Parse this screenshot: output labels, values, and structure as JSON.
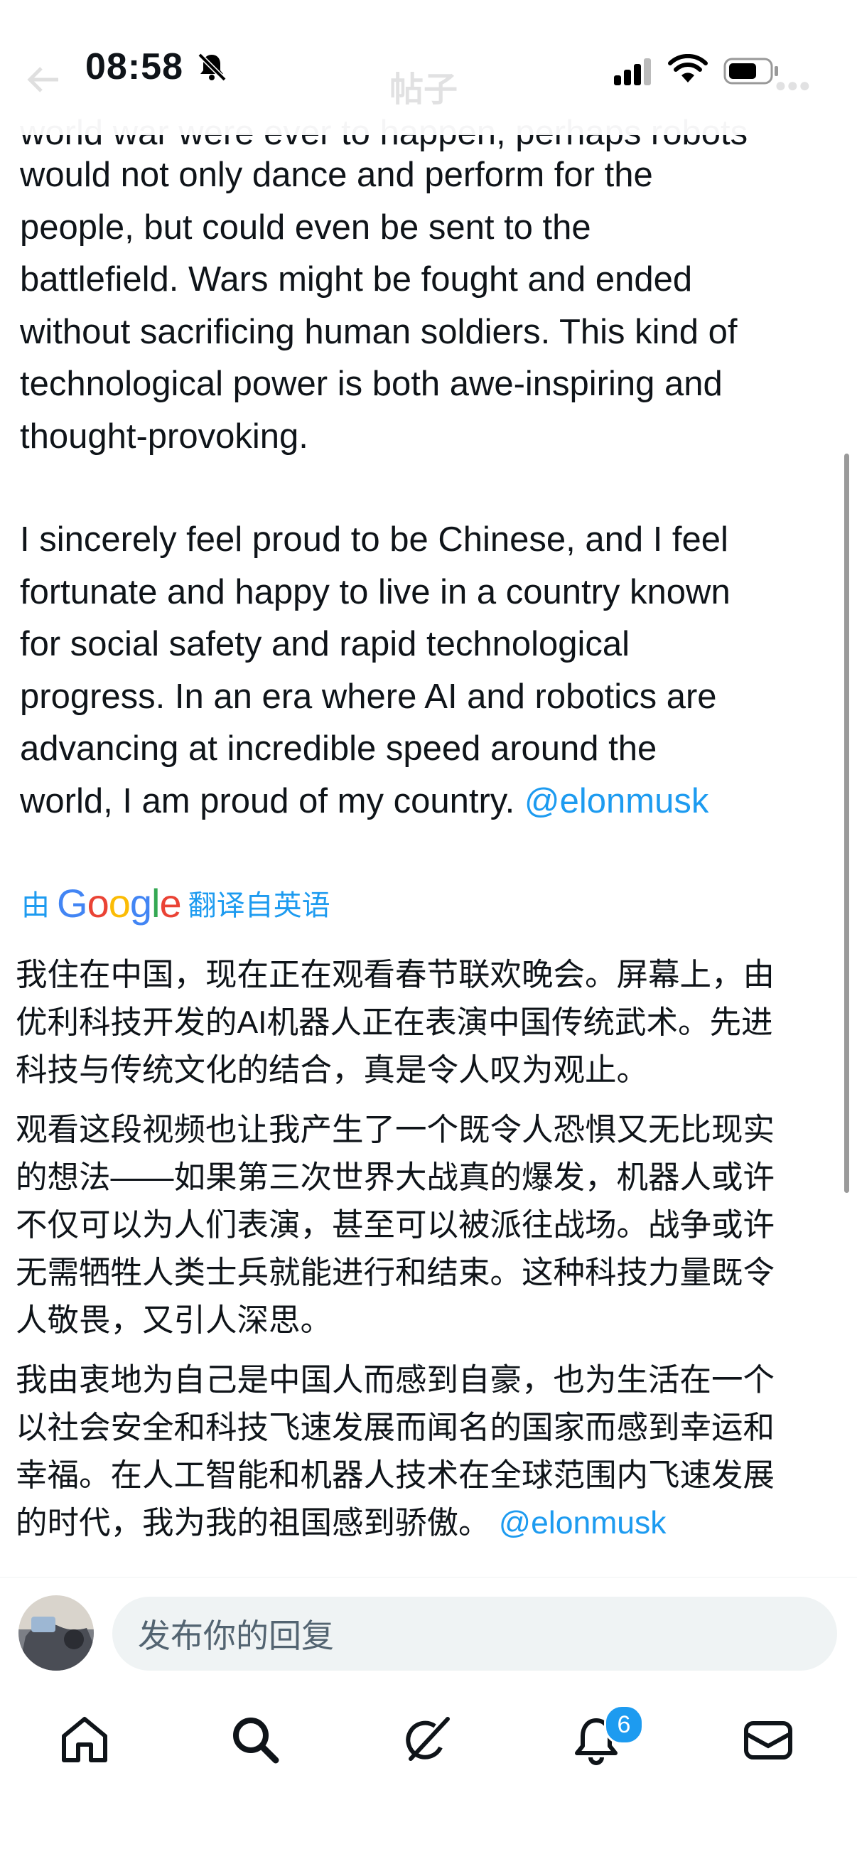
{
  "status_bar": {
    "time": "08:58",
    "ghost_title": "帖子"
  },
  "post": {
    "cut_line": "world war were ever to happen, perhaps robots",
    "en_paragraph_1": [
      "would not only dance and perform for the",
      "people, but could even be sent to the",
      "battlefield. Wars might be fought and ended",
      "without sacrificing human soldiers. This kind of",
      "technological power is both awe-inspiring and",
      "thought-provoking."
    ],
    "en_paragraph_2": [
      "I sincerely feel proud to be Chinese, and I feel",
      "fortunate and happy to live in a country known",
      "for social safety and rapid technological",
      "progress. In an era where AI and robotics are",
      "advancing at incredible speed around the"
    ],
    "en_last_line": "world, I am proud of my country.",
    "mention": "@elonmusk",
    "translation_prefix": "由",
    "translation_brand": "Google",
    "translation_suffix": "翻译自英语",
    "zh_paragraph_1": [
      "我住在中国，现在正在观看春节联欢晚会。屏幕上，由",
      "优利科技开发的AI机器人正在表演中国传统武术。先进",
      "科技与传统文化的结合，真是令人叹为观止。"
    ],
    "zh_paragraph_2": [
      "观看这段视频也让我产生了一个既令人恐惧又无比现实",
      "的想法——如果第三次世界大战真的爆发，机器人或许",
      "不仅可以为人们表演，甚至可以被派往战场。战争或许",
      "无需牺牲人类士兵就能进行和结束。这种科技力量既令",
      "人敬畏，又引人深思。"
    ],
    "zh_paragraph_3": [
      "我由衷地为自己是中国人而感到自豪，也为生活在一个",
      "以社会安全和科技飞速发展而闻名的国家而感到幸运和",
      "幸福。在人工智能和机器人技术在全球范围内飞速发展"
    ],
    "zh_last_line": "的时代，我为我的祖国感到骄傲。"
  },
  "reply": {
    "placeholder": "发布你的回复"
  },
  "tabs": {
    "notifications_badge": "6",
    "items": [
      "home-icon",
      "search-icon",
      "grok-icon",
      "bell-icon",
      "mail-icon"
    ]
  },
  "colors": {
    "accent": "#1d9bf0",
    "text": "#0f1419",
    "muted": "#536471",
    "input_bg": "#eff3f4"
  }
}
